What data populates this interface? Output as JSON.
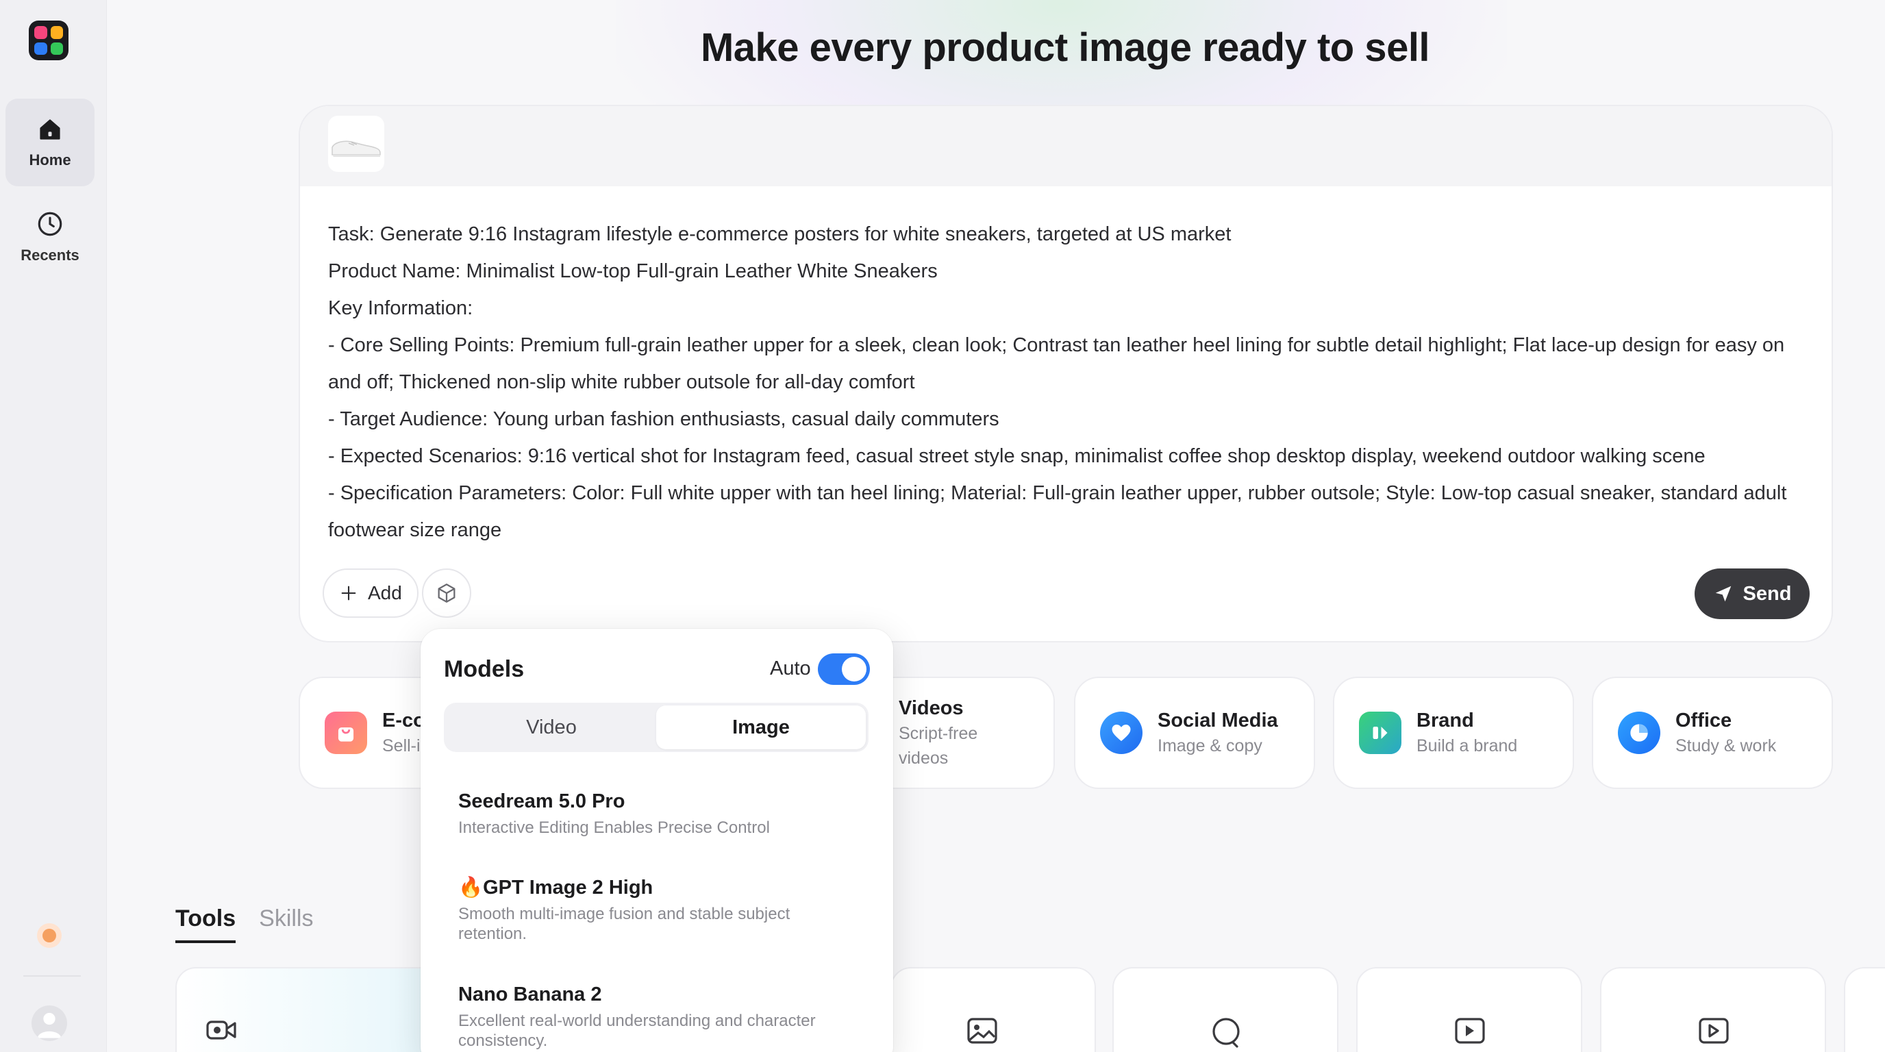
{
  "sidebar": {
    "items": [
      {
        "label": "Home",
        "icon": "home-icon",
        "active": true
      },
      {
        "label": "Recents",
        "icon": "clock-icon",
        "active": false
      }
    ]
  },
  "header": {
    "title": "Make every product image ready to sell"
  },
  "prompt": {
    "lines": [
      "Task: Generate 9:16 Instagram lifestyle e-commerce posters for white sneakers, targeted at US market",
      "Product Name: Minimalist Low-top Full-grain Leather White Sneakers",
      "Key Information:",
      "- Core Selling Points: Premium full-grain leather upper for a sleek, clean look; Contrast tan leather heel lining for subtle detail highlight; Flat lace-up design for easy on and off; Thickened non-slip white rubber outsole for all-day comfort",
      "- Target Audience: Young urban fashion enthusiasts, casual daily commuters",
      "- Expected Scenarios: 9:16 vertical shot for Instagram feed, casual street style snap, minimalist coffee shop desktop display, weekend outdoor walking scene",
      "- Specification Parameters: Color: Full white upper with tan heel lining; Material: Full-grain leather upper, rubber outsole; Style: Low-top casual sneaker, standard adult footwear size range"
    ],
    "add_label": "Add",
    "send_label": "Send"
  },
  "categories": [
    {
      "title": "E-co",
      "subtitle": "Sell-i"
    },
    {
      "title": "Videos",
      "subtitle": "Script-free videos"
    },
    {
      "title": "Social Media",
      "subtitle": "Image & copy"
    },
    {
      "title": "Brand",
      "subtitle": "Build a brand"
    },
    {
      "title": "Office",
      "subtitle": "Study & work"
    }
  ],
  "bottom_tabs": [
    {
      "label": "Tools",
      "active": true
    },
    {
      "label": "Skills",
      "active": false
    }
  ],
  "models_popup": {
    "title": "Models",
    "auto_label": "Auto",
    "auto_enabled": true,
    "segments": [
      {
        "label": "Video",
        "active": false
      },
      {
        "label": "Image",
        "active": true
      }
    ],
    "models": [
      {
        "name": "Seedream 5.0 Pro",
        "desc": "Interactive Editing Enables Precise Control"
      },
      {
        "name": "🔥GPT Image 2 High",
        "desc": "Smooth multi-image fusion and stable subject retention."
      },
      {
        "name": "Nano Banana 2",
        "desc": "Excellent real-world understanding and character consistency."
      }
    ]
  },
  "colors": {
    "accent": "#2d7cf6",
    "send_bg": "#3a3a3e"
  }
}
